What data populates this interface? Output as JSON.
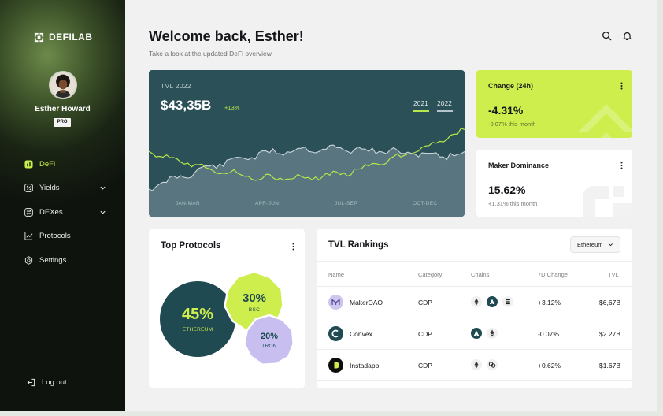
{
  "app": {
    "brand": "DEFILAB"
  },
  "user": {
    "name": "Esther Howard",
    "plan": "PRO"
  },
  "sidebar": {
    "items": [
      {
        "label": "DeFi",
        "icon": "chart-bar-icon",
        "active": true
      },
      {
        "label": "Yields",
        "icon": "percent-icon",
        "expandable": true
      },
      {
        "label": "DEXes",
        "icon": "exchange-icon",
        "expandable": true
      },
      {
        "label": "Protocols",
        "icon": "line-chart-icon"
      },
      {
        "label": "Settings",
        "icon": "gear-icon"
      }
    ],
    "logout": "Log out"
  },
  "header": {
    "title": "Welcome back, Esther!",
    "subtitle": "Take a look at the updated DeFi overview",
    "icons": [
      "search-icon",
      "bell-icon"
    ]
  },
  "tvl": {
    "label": "TVL 2022",
    "value": "$43,35B",
    "delta": "+13%",
    "years": [
      "2021",
      "2022"
    ],
    "quarters": [
      "JAN-MAR",
      "APR-JUN",
      "JUL-SEP",
      "OCT-DEC"
    ],
    "colors": {
      "bg": "#2b5058",
      "y2021": "#b6e84a",
      "y2022": "#b3c4cb"
    }
  },
  "change": {
    "title": "Change (24h)",
    "value": "-4.31%",
    "sub": "-0.07% this month",
    "color": "#cdee4c"
  },
  "dominance": {
    "title": "Maker Dominance",
    "value": "15.62%",
    "sub": "+1.31% this month"
  },
  "protocols": {
    "title": "Top Protocols",
    "bubbles": [
      {
        "pct": "45%",
        "label": "ETHEREUM",
        "color": "#1f4a52"
      },
      {
        "pct": "30%",
        "label": "BSC",
        "color": "#cdee4c"
      },
      {
        "pct": "20%",
        "label": "TRON",
        "color": "#c8bff0"
      }
    ]
  },
  "rankings": {
    "title": "TVL Rankings",
    "selected_chain": "Ethereum",
    "columns": [
      "Name",
      "Category",
      "Chains",
      "7D Change",
      "TVL"
    ],
    "rows": [
      {
        "name": "MakerDAO",
        "category": "CDP",
        "change": "+3.12%",
        "tvl": "$6,67B",
        "icon": "makerdao-icon",
        "chains": [
          "ethereum-icon",
          "avalanche-icon",
          "solana-icon"
        ]
      },
      {
        "name": "Convex",
        "category": "CDP",
        "change": "-0.07%",
        "tvl": "$2.27B",
        "icon": "convex-icon",
        "chains": [
          "avalanche-icon",
          "ethereum-icon"
        ]
      },
      {
        "name": "Instadapp",
        "category": "CDP",
        "change": "+0.62%",
        "tvl": "$1.67B",
        "icon": "instadapp-icon",
        "chains": [
          "ethereum-icon",
          "link-icon"
        ]
      }
    ]
  }
}
